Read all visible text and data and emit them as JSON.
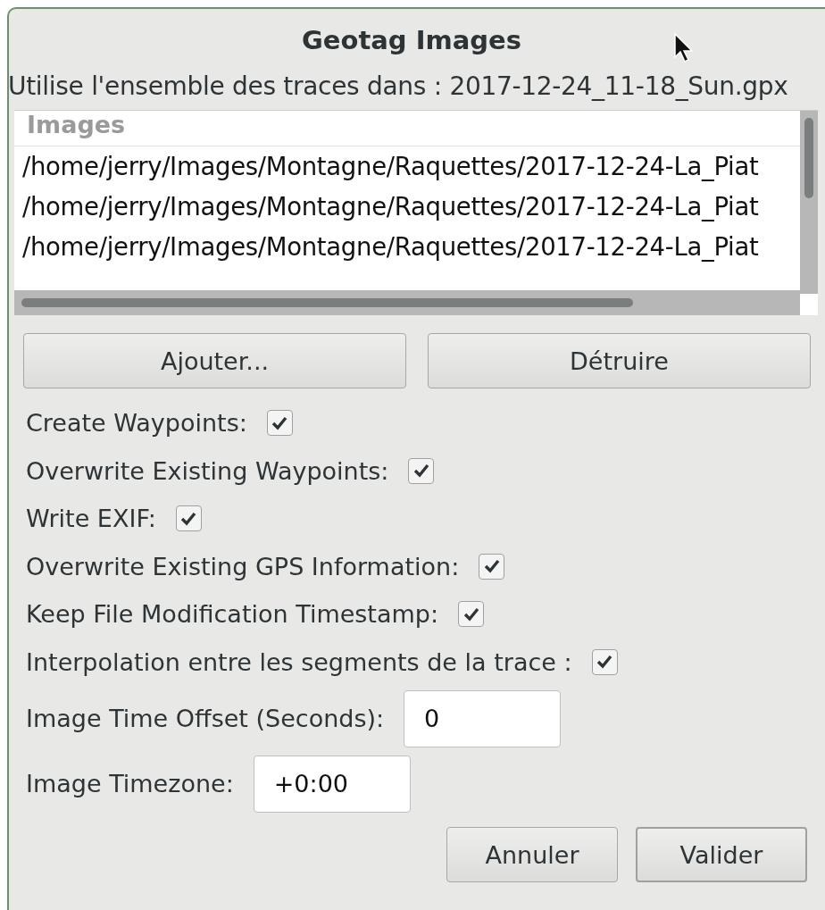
{
  "window": {
    "title": "Geotag Images"
  },
  "subtitle": "Utilise l'ensemble des traces dans : 2017-12-24_11-18_Sun.gpx",
  "image_list": {
    "header": "Images",
    "rows": [
      "/home/jerry/Images/Montagne/Raquettes/2017-12-24-La_Piat",
      "/home/jerry/Images/Montagne/Raquettes/2017-12-24-La_Piat",
      "/home/jerry/Images/Montagne/Raquettes/2017-12-24-La_Piat"
    ]
  },
  "list_buttons": [
    "Ajouter...",
    "Détruire"
  ],
  "options": [
    {
      "label": "Create Waypoints:",
      "checked": true
    },
    {
      "label": "Overwrite Existing Waypoints:",
      "checked": true
    },
    {
      "label": "Write EXIF:",
      "checked": true
    },
    {
      "label": "Overwrite Existing GPS Information:",
      "checked": true
    },
    {
      "label": "Keep File Modification Timestamp:",
      "checked": true
    },
    {
      "label": "Interpolation entre les segments de la trace :",
      "checked": true
    }
  ],
  "fields": [
    {
      "label": "Image Time Offset (Seconds):",
      "value": "0"
    },
    {
      "label": "Image Timezone:",
      "value": "+0:00"
    }
  ],
  "dialog_buttons": [
    "Annuler",
    "Valider"
  ]
}
